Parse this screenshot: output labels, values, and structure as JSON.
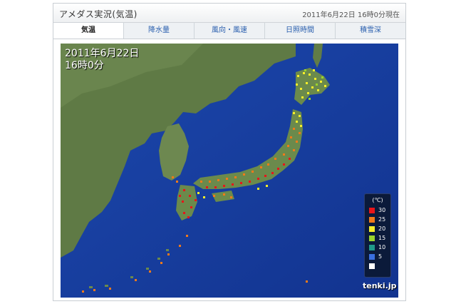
{
  "header": {
    "title": "アメダス実況(気温)",
    "timestamp": "2011年6月22日 16時0分現在"
  },
  "tabs": [
    {
      "label": "気温",
      "active": true
    },
    {
      "label": "降水量",
      "active": false
    },
    {
      "label": "風向・風速",
      "active": false
    },
    {
      "label": "日照時間",
      "active": false
    },
    {
      "label": "積雪深",
      "active": false
    }
  ],
  "map": {
    "date_line1": "2011年6月22日",
    "date_line2": "16時0分",
    "logo": "tenki.jp"
  },
  "legend": {
    "unit": "(℃)",
    "items": [
      {
        "label": "30",
        "color": "#e8151a"
      },
      {
        "label": "25",
        "color": "#f07a1a"
      },
      {
        "label": "20",
        "color": "#f6ee2a"
      },
      {
        "label": "15",
        "color": "#9bd42c"
      },
      {
        "label": "10",
        "color": "#1f9a8a"
      },
      {
        "label": "5",
        "color": "#3a6fe0"
      },
      {
        "label": "",
        "color": "#ffffff"
      }
    ]
  }
}
